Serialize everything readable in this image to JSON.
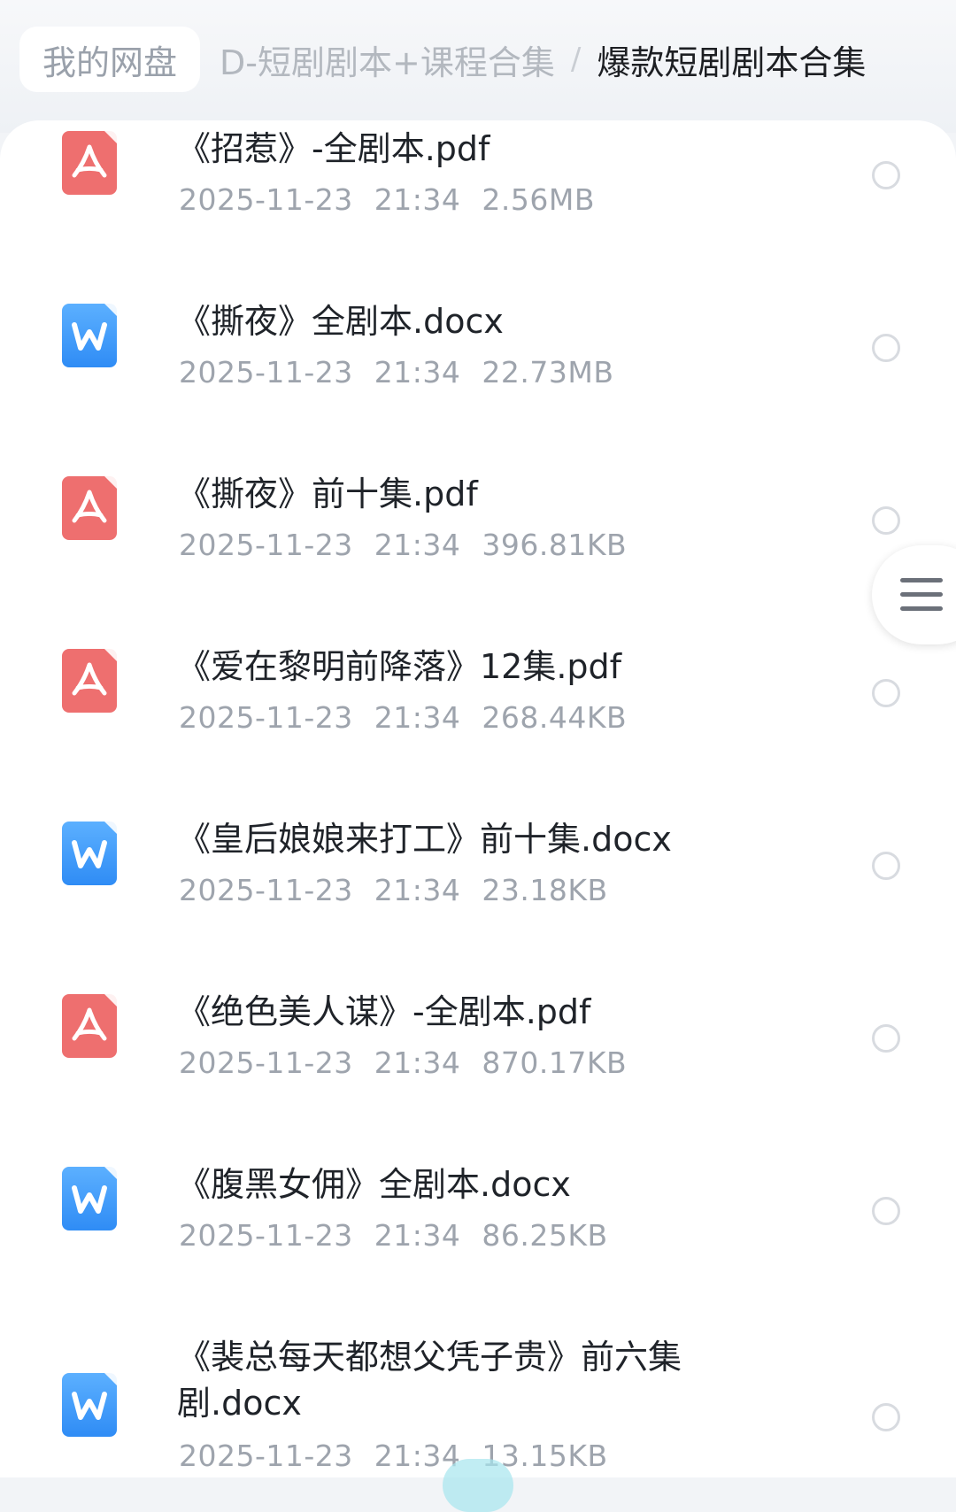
{
  "breadcrumb": {
    "root": "我的网盘",
    "middle": "D-短剧剧本+课程合集",
    "separator": "/",
    "current": "爆款短剧剧本合集"
  },
  "files": [
    {
      "name": "《招惹》-全剧本.pdf",
      "date": "2025-11-23",
      "time": "21:34",
      "size": "2.56MB",
      "type": "pdf",
      "icon": "pdf-file-icon"
    },
    {
      "name": "《撕夜》全剧本.docx",
      "date": "2025-11-23",
      "time": "21:34",
      "size": "22.73MB",
      "type": "doc",
      "icon": "word-file-icon"
    },
    {
      "name": "《撕夜》前十集.pdf",
      "date": "2025-11-23",
      "time": "21:34",
      "size": "396.81KB",
      "type": "pdf",
      "icon": "pdf-file-icon"
    },
    {
      "name": "《爱在黎明前降落》12集.pdf",
      "date": "2025-11-23",
      "time": "21:34",
      "size": "268.44KB",
      "type": "pdf",
      "icon": "pdf-file-icon"
    },
    {
      "name": "《皇后娘娘来打工》前十集.docx",
      "date": "2025-11-23",
      "time": "21:34",
      "size": "23.18KB",
      "type": "doc",
      "icon": "word-file-icon"
    },
    {
      "name": "《绝色美人谋》-全剧本.pdf",
      "date": "2025-11-23",
      "time": "21:34",
      "size": "870.17KB",
      "type": "pdf",
      "icon": "pdf-file-icon"
    },
    {
      "name": "《腹黑女佣》全剧本.docx",
      "date": "2025-11-23",
      "time": "21:34",
      "size": "86.25KB",
      "type": "doc",
      "icon": "word-file-icon"
    },
    {
      "name": "《裴总每天都想父凭子贵》前六集剧.docx",
      "date": "2025-11-23",
      "time": "21:34",
      "size": "13.15KB",
      "type": "doc",
      "icon": "word-file-icon"
    }
  ],
  "side_menu": {
    "icon": "menu-icon"
  },
  "colors": {
    "pdf": "#ee6f6f",
    "word": "#3d95f7",
    "title_text": "#1f2329",
    "meta_text": "#9ea4ad"
  }
}
